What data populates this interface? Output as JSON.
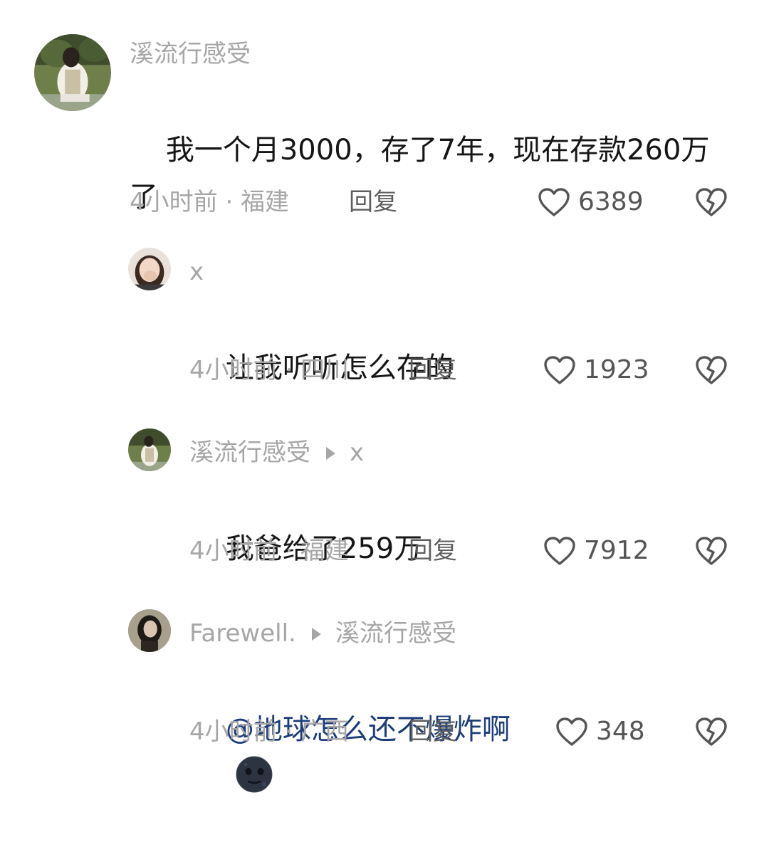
{
  "colors": {
    "name": "#a6a6a6",
    "text": "#161616",
    "mention": "#1c3d7a",
    "reply": "#5f5f5f",
    "icon": "#555555"
  },
  "comments": [
    {
      "author": "溪流行感受",
      "reply_to": "",
      "text": "我一个月3000，存了7年，现在存款260万了",
      "time": "4小时前",
      "location": "福建",
      "meta": "4小时前 · 福建",
      "reply_label": "回复",
      "likes": "6389",
      "avatar_icon": "avatar-photo-icon"
    },
    {
      "author": "x",
      "reply_to": "",
      "text": "让我听听怎么存的",
      "time": "4小时前",
      "location": "四川",
      "meta": "4小时前 · 四川",
      "reply_label": "回复",
      "likes": "1923",
      "avatar_icon": "avatar-photo-icon"
    },
    {
      "author": "溪流行感受",
      "reply_to": "x",
      "text": "我爸给了259万",
      "time": "4小时前",
      "location": "福建",
      "meta": "4小时前 · 福建",
      "reply_label": "回复",
      "likes": "7912",
      "avatar_icon": "avatar-photo-icon"
    },
    {
      "author": "Farewell.",
      "reply_to": "溪流行感受",
      "text": "@地球怎么还不爆炸啊",
      "emoji": "new-moon-face-emoji",
      "time": "4小时前",
      "location": "广西",
      "meta": "4小时前 · 广西",
      "reply_label": "回复",
      "likes": "348",
      "avatar_icon": "avatar-photo-icon"
    }
  ]
}
